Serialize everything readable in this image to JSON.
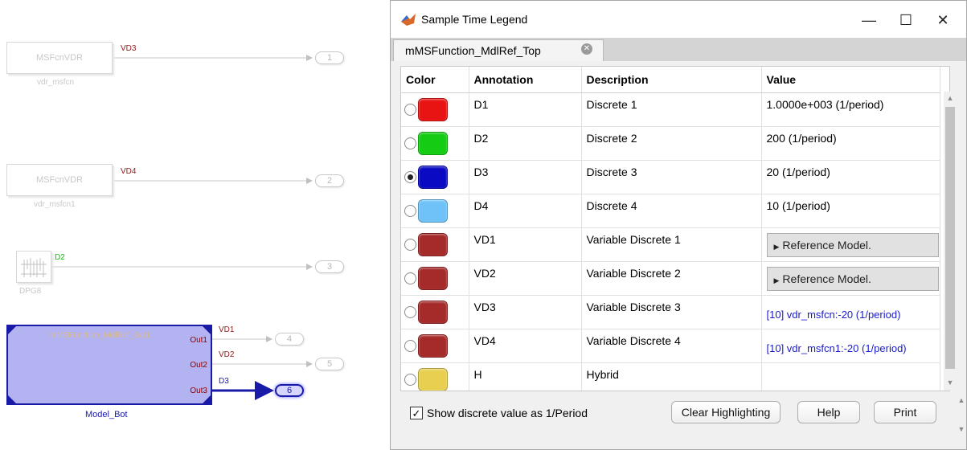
{
  "canvas": {
    "blocks": [
      {
        "text": "MSFcnVDR",
        "name": "vdr_msfcn",
        "signal": "VD3",
        "port": "1"
      },
      {
        "text": "MSFcnVDR",
        "name": "vdr_msfcn1",
        "signal": "VD4",
        "port": "2"
      }
    ],
    "dpg": {
      "name": "DPG8",
      "signal": "D2",
      "port": "3"
    },
    "model_bot": {
      "title": "mMSFunction_MdlRef_Bot1",
      "name": "Model_Bot",
      "outputs": [
        {
          "label": "Out1",
          "signal": "VD1",
          "port": "4"
        },
        {
          "label": "Out2",
          "signal": "VD2",
          "port": "5"
        },
        {
          "label": "Out3",
          "signal": "D3",
          "port": "6"
        }
      ]
    },
    "colors": {
      "vd_signal": "#8b1a1a",
      "d2_signal": "#11bb11",
      "d3_signal": "#1a1aa8",
      "model_fill": "#b3b3f2"
    }
  },
  "dialog": {
    "title": "Sample Time Legend",
    "controls": {
      "minimize": "—",
      "maximize": "☐",
      "close": "✕"
    },
    "tab": {
      "label": "mMSFunction_MdlRef_Top",
      "close": "✕"
    },
    "columns": [
      "Color",
      "Annotation",
      "Description",
      "Value"
    ],
    "rows": [
      {
        "color": "#e81414",
        "annotation": "D1",
        "description": "Discrete 1",
        "value": "1.0000e+003 (1/period)",
        "kind": "text",
        "selected": false
      },
      {
        "color": "#13cc13",
        "annotation": "D2",
        "description": "Discrete 2",
        "value": "200 (1/period)",
        "kind": "text",
        "selected": false
      },
      {
        "color": "#0a0ac2",
        "annotation": "D3",
        "description": "Discrete 3",
        "value": "20 (1/period)",
        "kind": "text",
        "selected": true
      },
      {
        "color": "#6ec2f7",
        "annotation": "D4",
        "description": "Discrete 4",
        "value": "10 (1/period)",
        "kind": "text",
        "selected": false
      },
      {
        "color": "#a52a2a",
        "annotation": "VD1",
        "description": "Variable Discrete 1",
        "value": "Reference Model.",
        "kind": "button",
        "selected": false
      },
      {
        "color": "#a52a2a",
        "annotation": "VD2",
        "description": "Variable Discrete 2",
        "value": "Reference Model.",
        "kind": "button",
        "selected": false
      },
      {
        "color": "#a52a2a",
        "annotation": "VD3",
        "description": "Variable Discrete 3",
        "value": "[10] vdr_msfcn:-20  (1/period)",
        "kind": "link",
        "selected": false
      },
      {
        "color": "#a52a2a",
        "annotation": "VD4",
        "description": "Variable Discrete 4",
        "value": "[10] vdr_msfcn1:-20  (1/period)",
        "kind": "link",
        "selected": false
      },
      {
        "color": "#e8cf50",
        "annotation": "H",
        "description": "Hybrid",
        "value": "",
        "kind": "text",
        "selected": false
      }
    ],
    "footer": {
      "checkbox_label": "Show discrete value as 1/Period",
      "checkbox_checked": true,
      "clear_label": "Clear Highlighting",
      "help_label": "Help",
      "print_label": "Print"
    }
  }
}
